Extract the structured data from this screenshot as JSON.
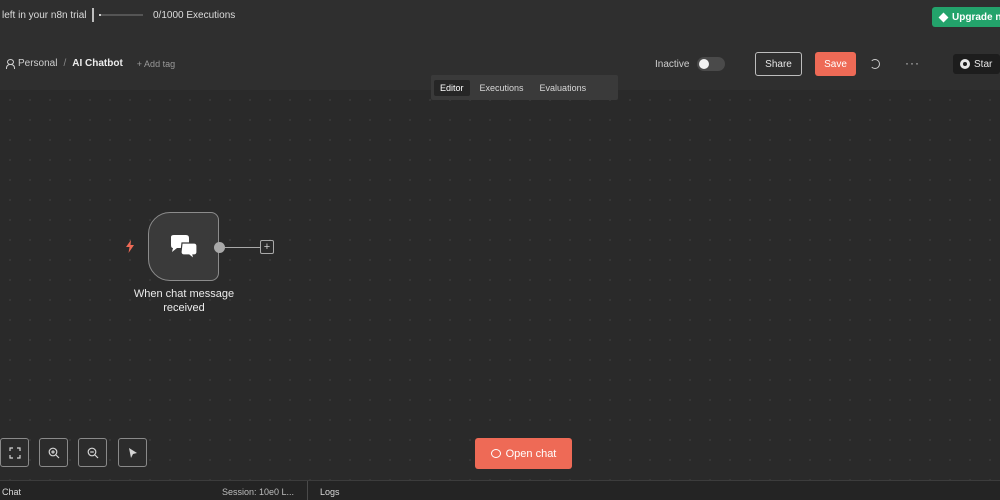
{
  "trial": {
    "text": "left in your n8n trial",
    "executions": "0/1000 Executions",
    "progress": 0.05,
    "upgrade_label": "Upgrade n"
  },
  "header": {
    "project": "Personal",
    "separator": "/",
    "workflow_name": "AI Chatbot",
    "add_tag": "+ Add tag",
    "inactive_label": "Inactive",
    "share_label": "Share",
    "save_label": "Save",
    "more_label": "···",
    "star_label": "Star"
  },
  "tabs": [
    {
      "label": "Editor",
      "active": true
    },
    {
      "label": "Executions",
      "active": false
    },
    {
      "label": "Evaluations",
      "active": false
    }
  ],
  "node": {
    "label": "When chat message received",
    "icon": "chat-icon",
    "add_label": "+"
  },
  "open_chat_label": "Open chat",
  "bottom": {
    "chat_label": "Chat",
    "session_label": "Session: 10e0 L...",
    "logs_label": "Logs"
  },
  "colors": {
    "accent": "#ee6a56",
    "upgrade": "#23a36b",
    "background": "#2a2a2a"
  }
}
